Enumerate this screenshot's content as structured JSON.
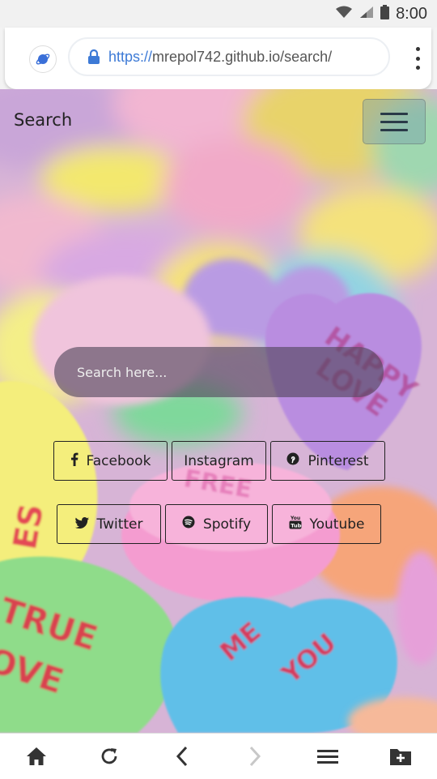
{
  "status_bar": {
    "time": "8:00"
  },
  "browser": {
    "url_protocol": "https://",
    "url_host": "mrepol742.github.io/search/"
  },
  "page": {
    "title": "Search",
    "search_placeholder": "Search here..."
  },
  "social_buttons": [
    {
      "label": "Facebook",
      "icon": "facebook-icon"
    },
    {
      "label": "Instagram",
      "icon": "none"
    },
    {
      "label": "Pinterest",
      "icon": "pinterest-icon"
    },
    {
      "label": "Twitter",
      "icon": "twitter-icon"
    },
    {
      "label": "Spotify",
      "icon": "spotify-icon"
    },
    {
      "label": "Youtube",
      "icon": "youtube-icon"
    }
  ],
  "bottom_nav": [
    "home-icon",
    "reload-icon",
    "back-icon",
    "forward-icon",
    "menu-icon",
    "add-tab-icon"
  ],
  "colors": {
    "url_protocol": "#3d7ad6",
    "search_box": "#50465a",
    "button_border": "#222222"
  }
}
